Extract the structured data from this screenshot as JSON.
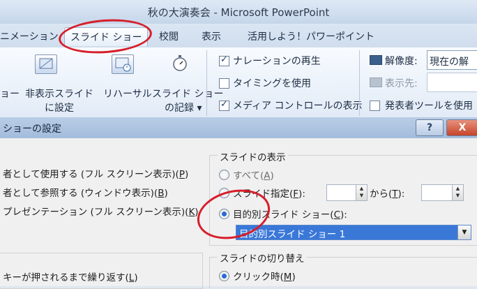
{
  "window": {
    "title": "秋の大演奏会 - Microsoft PowerPoint"
  },
  "tabs": [
    {
      "label": "ニメーション"
    },
    {
      "label": "スライド ショー"
    },
    {
      "label": "校閲"
    },
    {
      "label": "表示"
    },
    {
      "label": "活用しよう！パワーポイント"
    }
  ],
  "ribbon": {
    "btn_show_partial": "ョー",
    "hide_slide_line1": "非表示スライド",
    "hide_slide_line2": "に設定",
    "rehearsal": "リハーサル",
    "record_line1": "スライド ショー",
    "record_line2": "の記録 ▾",
    "narration": "ナレーションの再生",
    "timing": "タイミングを使用",
    "media_controls": "メディア コントロールの表示",
    "resolution_label": "解像度:",
    "resolution_value": "現在の解",
    "show_on": "表示先:",
    "presenter_tools": "発表者ツールを使用"
  },
  "dialog": {
    "title": "ショーの設定",
    "help": "?",
    "close": "X",
    "type_presenter_prefix": "者として使用する (フル スクリーン表示)(",
    "type_presenter_key": "P",
    "type_window_prefix": "者として参照する (ウィンドウ表示)(",
    "type_window_key": "B",
    "type_kiosk_prefix": "プレゼンテーション (フル スクリーン表示)(",
    "type_kiosk_key": "K",
    "loop_prefix": "キーが押されるまで繰り返す(",
    "loop_key": "L",
    "close_paren": ")",
    "show_slides_title": "スライドの表示",
    "all_prefix": "すべて(",
    "all_key": "A",
    "range_prefix": "スライド指定(",
    "range_key": "F",
    "range_suffix": "):",
    "range_to_prefix": "から(",
    "range_to_key": "T",
    "range_to_suffix": "):",
    "custom_prefix": "目的別スライド ショー(",
    "custom_key": "C",
    "custom_suffix": "):",
    "custom_show_value": "目的別スライド ショー 1",
    "advance_title": "スライドの切り替え",
    "manual_prefix": "クリック時(",
    "manual_key": "M"
  },
  "colors": {
    "annotation": "#d61e2a",
    "selection": "#3a78d8"
  },
  "icons": {
    "hide_slide": "hide-slide-icon",
    "rehearsal": "rehearse-timings-icon",
    "record": "stopwatch-icon",
    "resolution": "monitor-icon",
    "show_on": "display-icon"
  }
}
